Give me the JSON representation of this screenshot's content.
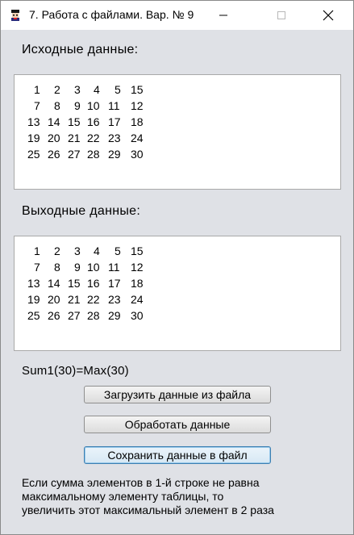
{
  "window": {
    "title": "7. Работа с файлами. Вар. № 9",
    "app_icon": "application-icon",
    "controls": {
      "minimize": "minimize-icon",
      "maximize": "maximize-icon",
      "close": "close-icon"
    }
  },
  "input": {
    "label": "Исходные данные:",
    "rows": [
      [
        "1",
        "2",
        "3",
        "4",
        "5",
        "15"
      ],
      [
        "7",
        "8",
        "9",
        "10",
        "11",
        "12"
      ],
      [
        "13",
        "14",
        "15",
        "16",
        "17",
        "18"
      ],
      [
        "19",
        "20",
        "21",
        "22",
        "23",
        "24"
      ],
      [
        "25",
        "26",
        "27",
        "28",
        "29",
        "30"
      ]
    ]
  },
  "output": {
    "label": "Выходные данные:",
    "rows": [
      [
        "1",
        "2",
        "3",
        "4",
        "5",
        "15"
      ],
      [
        "7",
        "8",
        "9",
        "10",
        "11",
        "12"
      ],
      [
        "13",
        "14",
        "15",
        "16",
        "17",
        "18"
      ],
      [
        "19",
        "20",
        "21",
        "22",
        "23",
        "24"
      ],
      [
        "25",
        "26",
        "27",
        "28",
        "29",
        "30"
      ]
    ]
  },
  "result_text": "Sum1(30)=Max(30)",
  "buttons": {
    "load": "Загрузить данные из файла",
    "process": "Обработать данные",
    "save": "Сохранить данные в файл"
  },
  "description": {
    "line1": "Если сумма элементов в 1-й строке не равна",
    "line2": "максимальному элементу таблицы, то",
    "line3": "увеличить этот максимальный элемент в 2 раза"
  }
}
